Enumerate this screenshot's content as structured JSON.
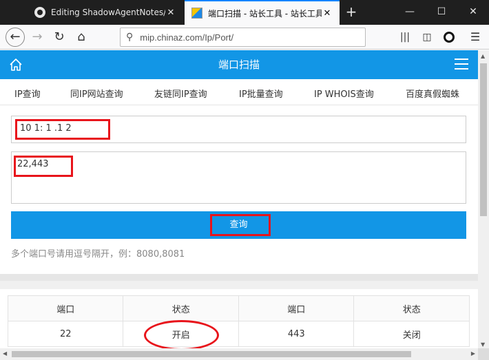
{
  "browser": {
    "tabs": [
      {
        "title": "Editing ShadowAgentNotes/vul",
        "favicon": "github-icon",
        "active": false
      },
      {
        "title": "端口扫描 - 站长工具 - 站长工具",
        "favicon": "chinaz-icon",
        "active": true
      }
    ],
    "url": {
      "host": "mip.chinaz.com",
      "path": "/Ip/Port/"
    },
    "close_glyph": "✕",
    "newtab_glyph": "+"
  },
  "header": {
    "title": "端口扫描"
  },
  "subnav": [
    "IP查询",
    "同IP网站查询",
    "友链同IP查询",
    "IP批量查询",
    "IP WHOIS查询",
    "百度真假蜘蛛"
  ],
  "form": {
    "ip_value": "10  1:   1    .1  2",
    "port_value": "22,443",
    "button_label": "查询",
    "hint": "多个端口号请用逗号隔开，例：8080,8081"
  },
  "table": {
    "headers": [
      "端口",
      "状态",
      "端口",
      "状态"
    ],
    "rows": [
      {
        "port1": "22",
        "status1": "开启",
        "port2": "443",
        "status2": "关闭"
      }
    ]
  },
  "colors": {
    "accent": "#1296e6",
    "open": "#3da83d",
    "closed": "#e8141b",
    "annotation": "#e8141b"
  }
}
